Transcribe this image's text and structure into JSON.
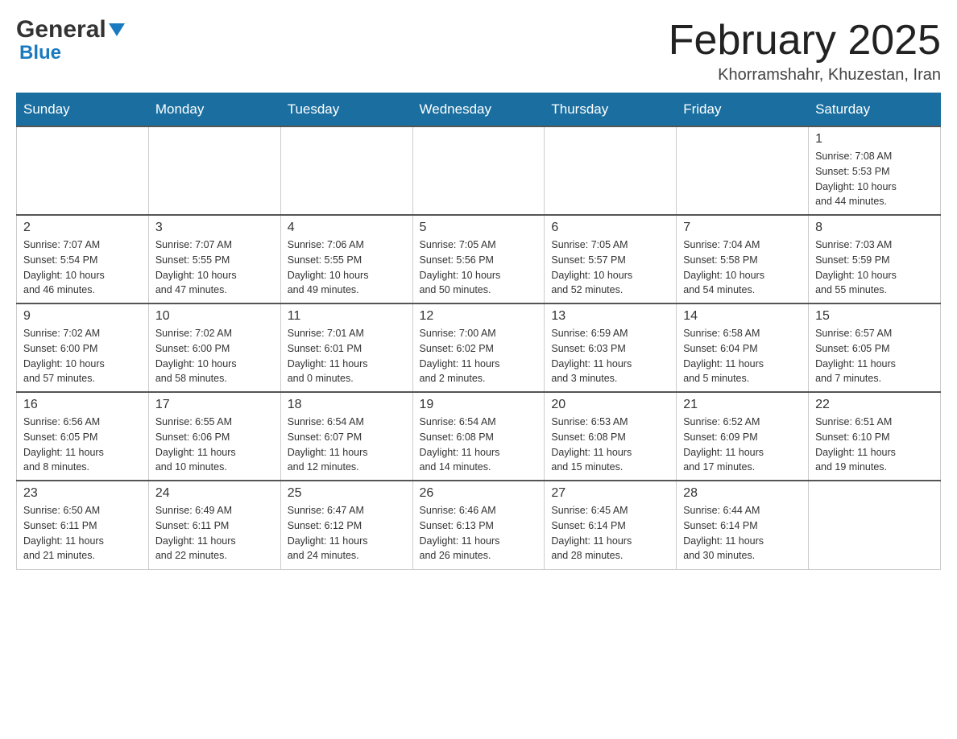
{
  "header": {
    "logo_general": "General",
    "logo_blue": "Blue",
    "month_title": "February 2025",
    "location": "Khorramshahr, Khuzestan, Iran"
  },
  "days_of_week": [
    "Sunday",
    "Monday",
    "Tuesday",
    "Wednesday",
    "Thursday",
    "Friday",
    "Saturday"
  ],
  "weeks": [
    {
      "days": [
        {
          "date": "",
          "info": ""
        },
        {
          "date": "",
          "info": ""
        },
        {
          "date": "",
          "info": ""
        },
        {
          "date": "",
          "info": ""
        },
        {
          "date": "",
          "info": ""
        },
        {
          "date": "",
          "info": ""
        },
        {
          "date": "1",
          "info": "Sunrise: 7:08 AM\nSunset: 5:53 PM\nDaylight: 10 hours\nand 44 minutes."
        }
      ]
    },
    {
      "days": [
        {
          "date": "2",
          "info": "Sunrise: 7:07 AM\nSunset: 5:54 PM\nDaylight: 10 hours\nand 46 minutes."
        },
        {
          "date": "3",
          "info": "Sunrise: 7:07 AM\nSunset: 5:55 PM\nDaylight: 10 hours\nand 47 minutes."
        },
        {
          "date": "4",
          "info": "Sunrise: 7:06 AM\nSunset: 5:55 PM\nDaylight: 10 hours\nand 49 minutes."
        },
        {
          "date": "5",
          "info": "Sunrise: 7:05 AM\nSunset: 5:56 PM\nDaylight: 10 hours\nand 50 minutes."
        },
        {
          "date": "6",
          "info": "Sunrise: 7:05 AM\nSunset: 5:57 PM\nDaylight: 10 hours\nand 52 minutes."
        },
        {
          "date": "7",
          "info": "Sunrise: 7:04 AM\nSunset: 5:58 PM\nDaylight: 10 hours\nand 54 minutes."
        },
        {
          "date": "8",
          "info": "Sunrise: 7:03 AM\nSunset: 5:59 PM\nDaylight: 10 hours\nand 55 minutes."
        }
      ]
    },
    {
      "days": [
        {
          "date": "9",
          "info": "Sunrise: 7:02 AM\nSunset: 6:00 PM\nDaylight: 10 hours\nand 57 minutes."
        },
        {
          "date": "10",
          "info": "Sunrise: 7:02 AM\nSunset: 6:00 PM\nDaylight: 10 hours\nand 58 minutes."
        },
        {
          "date": "11",
          "info": "Sunrise: 7:01 AM\nSunset: 6:01 PM\nDaylight: 11 hours\nand 0 minutes."
        },
        {
          "date": "12",
          "info": "Sunrise: 7:00 AM\nSunset: 6:02 PM\nDaylight: 11 hours\nand 2 minutes."
        },
        {
          "date": "13",
          "info": "Sunrise: 6:59 AM\nSunset: 6:03 PM\nDaylight: 11 hours\nand 3 minutes."
        },
        {
          "date": "14",
          "info": "Sunrise: 6:58 AM\nSunset: 6:04 PM\nDaylight: 11 hours\nand 5 minutes."
        },
        {
          "date": "15",
          "info": "Sunrise: 6:57 AM\nSunset: 6:05 PM\nDaylight: 11 hours\nand 7 minutes."
        }
      ]
    },
    {
      "days": [
        {
          "date": "16",
          "info": "Sunrise: 6:56 AM\nSunset: 6:05 PM\nDaylight: 11 hours\nand 8 minutes."
        },
        {
          "date": "17",
          "info": "Sunrise: 6:55 AM\nSunset: 6:06 PM\nDaylight: 11 hours\nand 10 minutes."
        },
        {
          "date": "18",
          "info": "Sunrise: 6:54 AM\nSunset: 6:07 PM\nDaylight: 11 hours\nand 12 minutes."
        },
        {
          "date": "19",
          "info": "Sunrise: 6:54 AM\nSunset: 6:08 PM\nDaylight: 11 hours\nand 14 minutes."
        },
        {
          "date": "20",
          "info": "Sunrise: 6:53 AM\nSunset: 6:08 PM\nDaylight: 11 hours\nand 15 minutes."
        },
        {
          "date": "21",
          "info": "Sunrise: 6:52 AM\nSunset: 6:09 PM\nDaylight: 11 hours\nand 17 minutes."
        },
        {
          "date": "22",
          "info": "Sunrise: 6:51 AM\nSunset: 6:10 PM\nDaylight: 11 hours\nand 19 minutes."
        }
      ]
    },
    {
      "days": [
        {
          "date": "23",
          "info": "Sunrise: 6:50 AM\nSunset: 6:11 PM\nDaylight: 11 hours\nand 21 minutes."
        },
        {
          "date": "24",
          "info": "Sunrise: 6:49 AM\nSunset: 6:11 PM\nDaylight: 11 hours\nand 22 minutes."
        },
        {
          "date": "25",
          "info": "Sunrise: 6:47 AM\nSunset: 6:12 PM\nDaylight: 11 hours\nand 24 minutes."
        },
        {
          "date": "26",
          "info": "Sunrise: 6:46 AM\nSunset: 6:13 PM\nDaylight: 11 hours\nand 26 minutes."
        },
        {
          "date": "27",
          "info": "Sunrise: 6:45 AM\nSunset: 6:14 PM\nDaylight: 11 hours\nand 28 minutes."
        },
        {
          "date": "28",
          "info": "Sunrise: 6:44 AM\nSunset: 6:14 PM\nDaylight: 11 hours\nand 30 minutes."
        },
        {
          "date": "",
          "info": ""
        }
      ]
    }
  ]
}
